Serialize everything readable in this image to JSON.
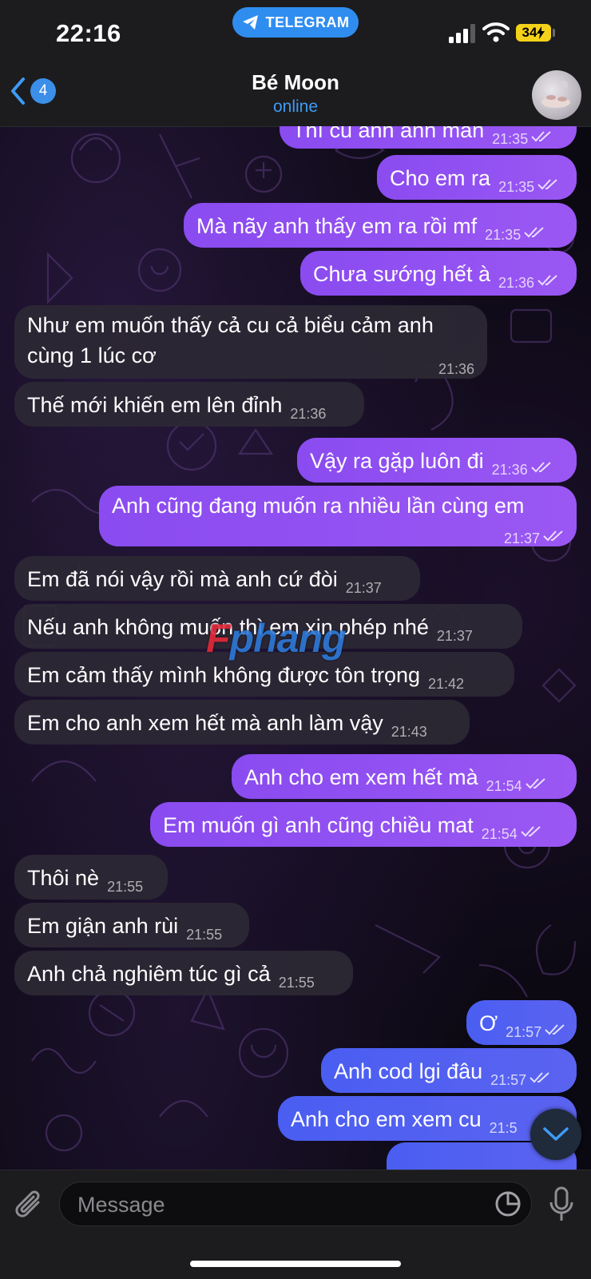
{
  "status_bar": {
    "time": "22:16",
    "app_pill": "TELEGRAM",
    "battery": "34"
  },
  "header": {
    "back_badge": "4",
    "title": "Bé Moon",
    "status": "online"
  },
  "watermark": {
    "red": "F",
    "blue": "phang"
  },
  "messages": [
    {
      "dir": "out",
      "text": "Thì cu anh anh mãn",
      "time": "21:35"
    },
    {
      "dir": "out",
      "text": "Cho em ra",
      "time": "21:35"
    },
    {
      "dir": "out",
      "text": "Mà nãy anh thấy em ra rồi mf",
      "time": "21:35"
    },
    {
      "dir": "out",
      "text": "Chưa sướng hết à",
      "time": "21:36"
    },
    {
      "dir": "in",
      "text": "Như em muốn thấy cả cu cả biểu cảm anh cùng 1 lúc cơ",
      "time": "21:36"
    },
    {
      "dir": "in",
      "text": "Thế mới khiến em lên đỉnh",
      "time": "21:36"
    },
    {
      "dir": "out",
      "text": "Vậy ra gặp luôn đi",
      "time": "21:36"
    },
    {
      "dir": "out",
      "text": "Anh cũng đang muốn ra nhiều lần cùng em",
      "time": "21:37"
    },
    {
      "dir": "in",
      "text": "Em đã nói vậy rồi mà anh cứ đòi",
      "time": "21:37"
    },
    {
      "dir": "in",
      "text": "Nếu anh không muốn thì em xin phép nhé",
      "time": "21:37"
    },
    {
      "dir": "in",
      "text": "Em cảm thấy mình không được tôn trọng",
      "time": "21:42"
    },
    {
      "dir": "in",
      "text": "Em cho anh xem hết mà anh làm vậy",
      "time": "21:43"
    },
    {
      "dir": "out",
      "text": "Anh cho em xem hết mà",
      "time": "21:54"
    },
    {
      "dir": "out",
      "text": "Em muốn gì anh cũng chiều mat",
      "time": "21:54"
    },
    {
      "dir": "in",
      "text": "Thôi nè",
      "time": "21:55"
    },
    {
      "dir": "in",
      "text": "Em giận anh rùi",
      "time": "21:55"
    },
    {
      "dir": "in",
      "text": "Anh chả nghiêm túc gì cả",
      "time": "21:55"
    },
    {
      "dir": "out",
      "text": "Ơ",
      "time": "21:57"
    },
    {
      "dir": "out",
      "text": "Anh cod lgi đâu",
      "time": "21:57"
    },
    {
      "dir": "out",
      "text": "Anh cho em xem cu",
      "time": "21:5"
    }
  ],
  "input": {
    "placeholder": "Message"
  },
  "colors": {
    "accent": "#3e9bf5",
    "outgoing_purple": "#9a57f3",
    "outgoing_blue": "#5b63f0",
    "incoming": "#2d2834"
  }
}
